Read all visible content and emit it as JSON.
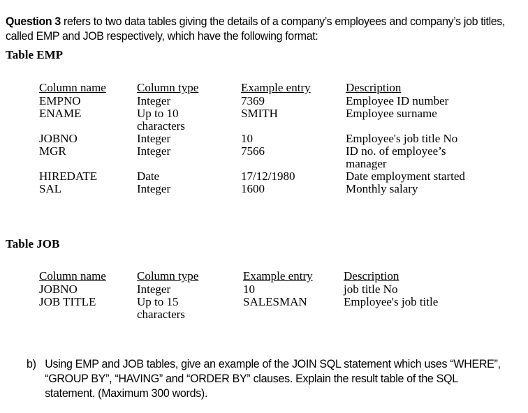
{
  "intro": {
    "lead": "Question 3",
    "body": " refers to two data tables giving the details of a company’s employees and company’s job titles, called EMP and JOB respectively, which have the following format:"
  },
  "tables": [
    {
      "id": "emp",
      "caption": "Table EMP",
      "headers": [
        "Column name",
        "Column type",
        "Example entry",
        "Description"
      ],
      "rows": [
        [
          "EMPNO",
          "Integer",
          "7369",
          "Employee ID number"
        ],
        [
          "ENAME",
          "Up to 10\ncharacters",
          "SMITH",
          "Employee surname"
        ],
        [
          "JOBNO",
          "Integer",
          "10",
          "Employee's job title No"
        ],
        [
          "MGR",
          "Integer",
          "7566",
          "ID no. of employee’s\nmanager"
        ],
        [
          "HIREDATE",
          "Date",
          "17/12/1980",
          "Date employment started"
        ],
        [
          "SAL",
          "Integer",
          "1600",
          "Monthly salary"
        ]
      ]
    },
    {
      "id": "job",
      "caption": "Table JOB",
      "headers": [
        "Column name",
        "Column type",
        "Example entry",
        "Description"
      ],
      "rows": [
        [
          "JOBNO",
          "Integer",
          "10",
          "job title No"
        ],
        [
          "JOB TITLE",
          "Up to 15\ncharacters",
          "SALESMAN",
          "Employee's job title"
        ]
      ]
    }
  ],
  "question_b": {
    "marker": "b)",
    "text": "Using EMP and JOB tables, give an example of the JOIN SQL statement which uses “WHERE”, “GROUP BY”, “HAVING” and “ORDER BY” clauses. Explain the result table of the SQL statement. (Maximum 300 words)."
  }
}
